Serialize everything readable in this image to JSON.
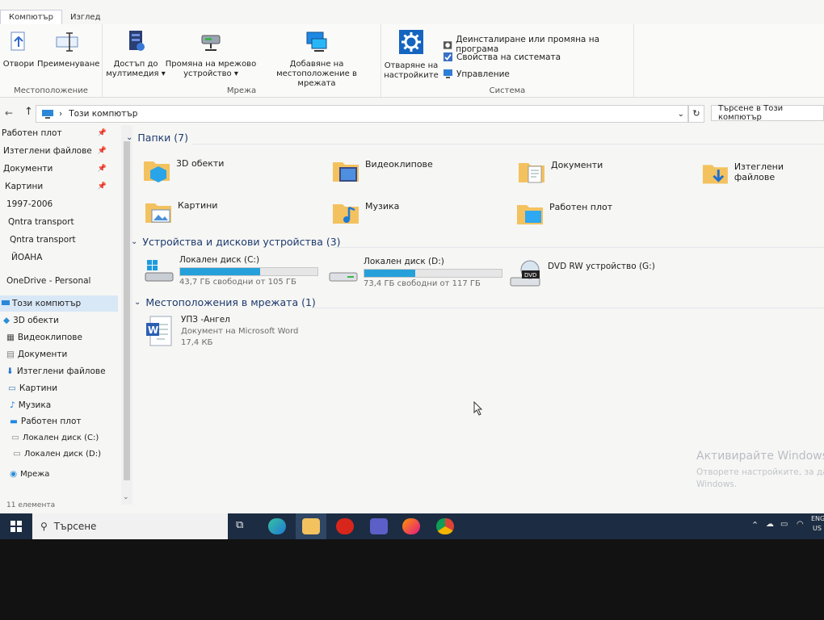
{
  "ribbon": {
    "tabs": [
      "Компютър",
      "Изглед"
    ],
    "groups": {
      "location": {
        "label": "Местоположение",
        "open": "Отвори",
        "rename": "Преименуване"
      },
      "network": {
        "label": "Мрежа",
        "media": [
          "Достъп до",
          "мултимедия ▾"
        ],
        "map_drive": [
          "Промяна на мрежово",
          "устройство ▾"
        ],
        "add_location": [
          "Добавяне на",
          "местоположение в мрежата"
        ]
      },
      "system": {
        "label": "Система",
        "open_settings": [
          "Отваряне на",
          "настройките"
        ],
        "uninstall": "Деинсталиране или промяна на програма",
        "properties": "Свойства на системата",
        "manage": "Управление"
      }
    }
  },
  "address": {
    "path": "Този компютър",
    "search_placeholder": "Търсене в Този компютър"
  },
  "sidebar": {
    "items": [
      {
        "label": "Работен плот",
        "pinned": true
      },
      {
        "label": "Изтеглени файлове",
        "pinned": true
      },
      {
        "label": "Документи",
        "pinned": true
      },
      {
        "label": "Картини",
        "pinned": true
      },
      {
        "label": "1997-2006"
      },
      {
        "label": "Qntra transport"
      },
      {
        "label": "Qntra transport"
      },
      {
        "label": "ЙОАНА"
      },
      {
        "label": "OneDrive - Personal"
      },
      {
        "label": "Този компютър"
      },
      {
        "label": "3D обекти"
      },
      {
        "label": "Видеоклипове"
      },
      {
        "label": "Документи"
      },
      {
        "label": "Изтеглени файлове"
      },
      {
        "label": "Картини"
      },
      {
        "label": "Музика"
      },
      {
        "label": "Работен плот"
      },
      {
        "label": "Локален диск (C:)"
      },
      {
        "label": "Локален диск (D:)"
      },
      {
        "label": "Мрежа"
      }
    ]
  },
  "folders": {
    "title": "Папки (7)",
    "items": [
      "3D обекти",
      "Видеоклипове",
      "Документи",
      "Изтеглени файлове",
      "Картини",
      "Музика",
      "Работен плот"
    ]
  },
  "devices": {
    "title": "Устройства и дискови устройства (3)",
    "drives": [
      {
        "name": "Локален диск (C:)",
        "free": "43,7 ГБ свободни от 105 ГБ",
        "used_fraction": 0.58
      },
      {
        "name": "Локален диск (D:)",
        "free": "73,4 ГБ свободни от 117 ГБ",
        "used_fraction": 0.37
      },
      {
        "name": "DVD RW устройство (G:)"
      }
    ]
  },
  "network_locations": {
    "title": "Местоположения в мрежата (1)",
    "item": {
      "name": "УПЗ -Ангел",
      "type": "Документ на Microsoft Word",
      "size": "17,4 КБ"
    }
  },
  "status": "11 елемента",
  "watermark": {
    "line1": "Активирайте Windows",
    "line2": "Отворете настройките, за да",
    "line3": "Windows."
  },
  "taskbar": {
    "search": "Търсене",
    "lang": "ENG",
    "region": "US"
  },
  "colors": {
    "accent": "#26a0da",
    "taskbar": "#1c2c42",
    "section_title": "#1d3a6e"
  }
}
